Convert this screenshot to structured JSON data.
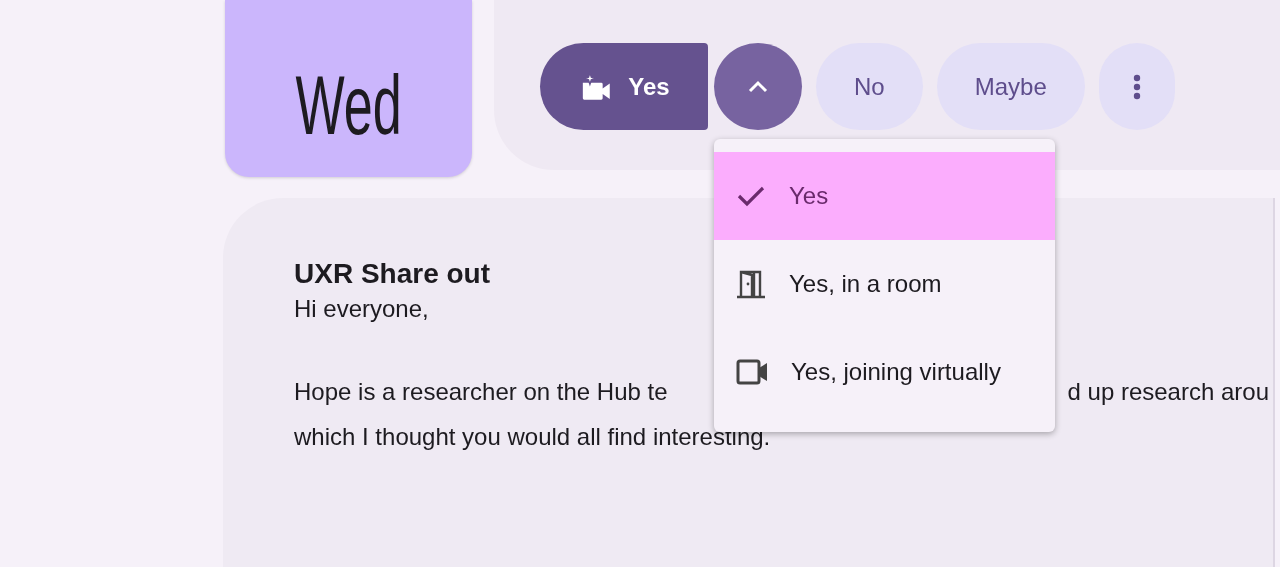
{
  "date_card": {
    "day": "Wed"
  },
  "rsvp": {
    "choices": [
      {
        "label": "Yes",
        "kind": "split",
        "selected": true
      },
      {
        "label": "No",
        "kind": "plain",
        "selected": false
      },
      {
        "label": "Maybe",
        "kind": "plain",
        "selected": false
      }
    ],
    "dropdown": {
      "expanded": true
    },
    "menu": [
      {
        "label": "Yes",
        "kind": "check",
        "selected": true
      },
      {
        "label": "Yes, in a room",
        "kind": "room",
        "selected": false
      },
      {
        "label": "Yes, joining virtually",
        "kind": "video",
        "selected": false
      }
    ]
  },
  "event": {
    "title": "UXR Share out",
    "greeting": "Hi everyone,",
    "lines": [
      [
        "Hope is a researcher on the Hub te",
        "d up research arou"
      ],
      [
        "which I thought you would all find interesting."
      ]
    ]
  }
}
